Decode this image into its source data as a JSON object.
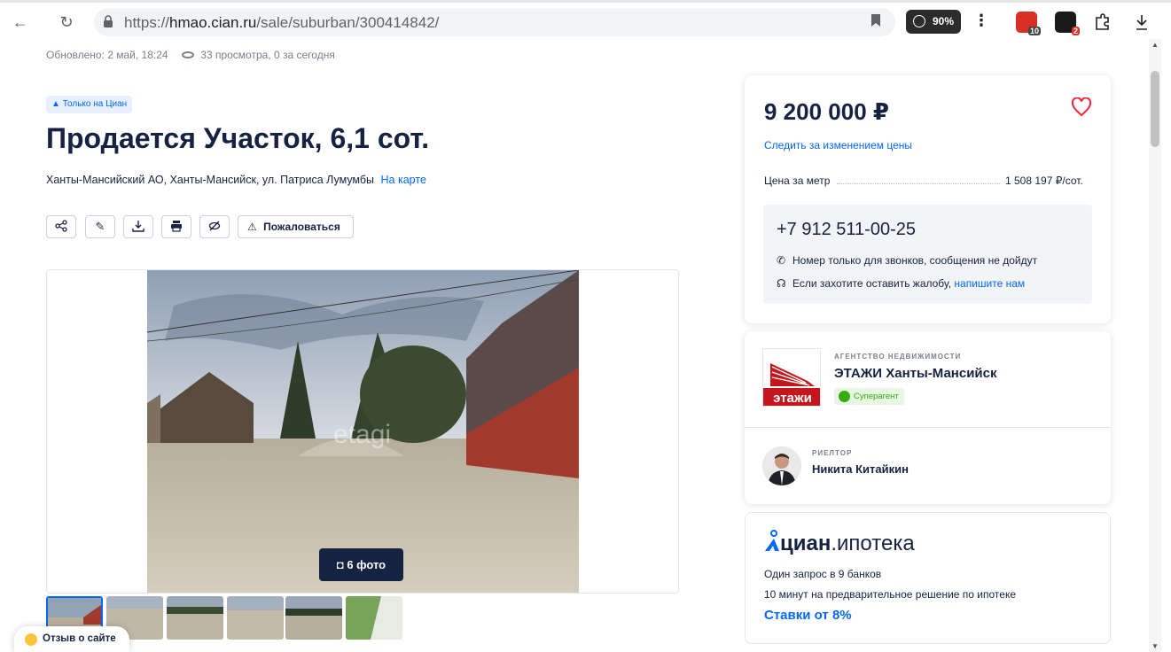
{
  "browser": {
    "url_prefix": "https://",
    "url_host": "hmao.cian.ru",
    "url_path": "/sale/suburban/300414842/",
    "zoom": "90%",
    "ext1_badge": "10",
    "ext2_badge": "2"
  },
  "listing": {
    "meta_updated": "Обновлено: 2 май, 18:24",
    "meta_views": "33 просмотра, 0 за сегодня",
    "only_badge": "Только на Циан",
    "title": "Продается Участок, 6,1 сот.",
    "address": "Ханты-Мансийский АО, Ханты-Мансийск, ул. Патриса Лумумбы",
    "map_link": "На карте",
    "complain_label": "Пожаловаться",
    "photo_count": "6 фото",
    "watermark": "etagi"
  },
  "price_card": {
    "price": "9 200 000 ₽",
    "follow_link": "Следить за изменением цены",
    "ppm_label": "Цена за метр",
    "ppm_value": "1 508 197 ₽/сот.",
    "phone": "+7 912 511-00-25",
    "note_calls": "Номер только для звонков, сообщения не дойдут",
    "note_complaint": "Если захотите оставить жалобу,",
    "note_complaint_link": "напишите нам"
  },
  "agency": {
    "type": "АГЕНТСТВО НЕДВИЖИМОСТИ",
    "name": "ЭТАЖИ Ханты-Мансийск",
    "badge": "Суперагент",
    "logo_text": "этажи",
    "realtor_role": "РИЕЛТОР",
    "realtor_name": "Никита Китайкин"
  },
  "mortgage": {
    "logo_brand": "циан",
    "logo_suffix": ".ипотека",
    "line1": "Один запрос в 9 банков",
    "line2": "10 минут на предварительное решение по ипотеке",
    "rates": "Ставки от 8%"
  },
  "feedback": {
    "label": "Отзыв о сайте"
  },
  "colors": {
    "accent": "#0468ff",
    "text": "#152242",
    "heart": "#ff1f34",
    "superagent": "#34ac0a",
    "agency_red": "#c4161c"
  }
}
